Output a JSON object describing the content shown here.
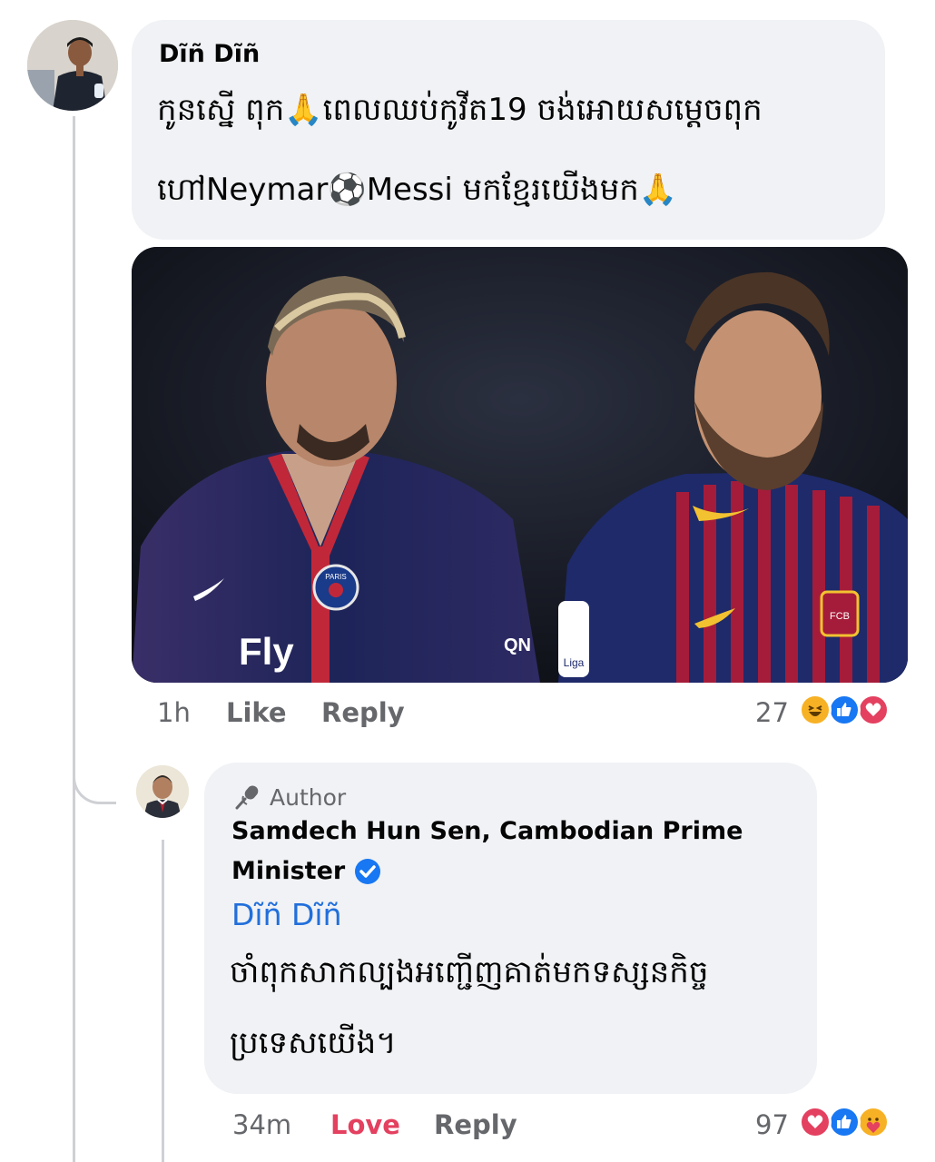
{
  "comment": {
    "author": "Dĩñ Dĩñ",
    "text_line1": "កូនស្នើ ពុក🙏ពេលឈប់កូវីត19 ចង់អោយសម្តេចពុក",
    "text_line2": "ហៅNeymar⚽Messi មកខ្មែរយើងមក🙏",
    "time": "1h",
    "like_label": "Like",
    "reply_label": "Reply",
    "reaction_count": "27",
    "reactions": [
      "haha-icon",
      "like-icon",
      "love-icon"
    ],
    "photo_text": [
      "PARIS",
      "Fly",
      "QN",
      "Liga",
      "FCB"
    ]
  },
  "reply": {
    "badge_label": "Author",
    "author_line1": "Samdech Hun Sen, Cambodian Prime",
    "author_line2": "Minister",
    "mention": "Dĩñ Dĩñ",
    "text_line1": "ចាំពុកសាកល្បងអញ្ជើញគាត់មកទស្សនកិច្ច",
    "text_line2": "ប្រទេសយើង។",
    "time": "34m",
    "love_label": "Love",
    "reply_label": "Reply",
    "reaction_count": "97",
    "reactions": [
      "love-icon",
      "like-icon",
      "care-icon"
    ]
  },
  "colors": {
    "bubble": "#f0f2f5",
    "link": "#216fdb",
    "love": "#e4405f",
    "like": "#1877f2",
    "secondary_text": "#65676b",
    "verified": "#1877f2"
  }
}
